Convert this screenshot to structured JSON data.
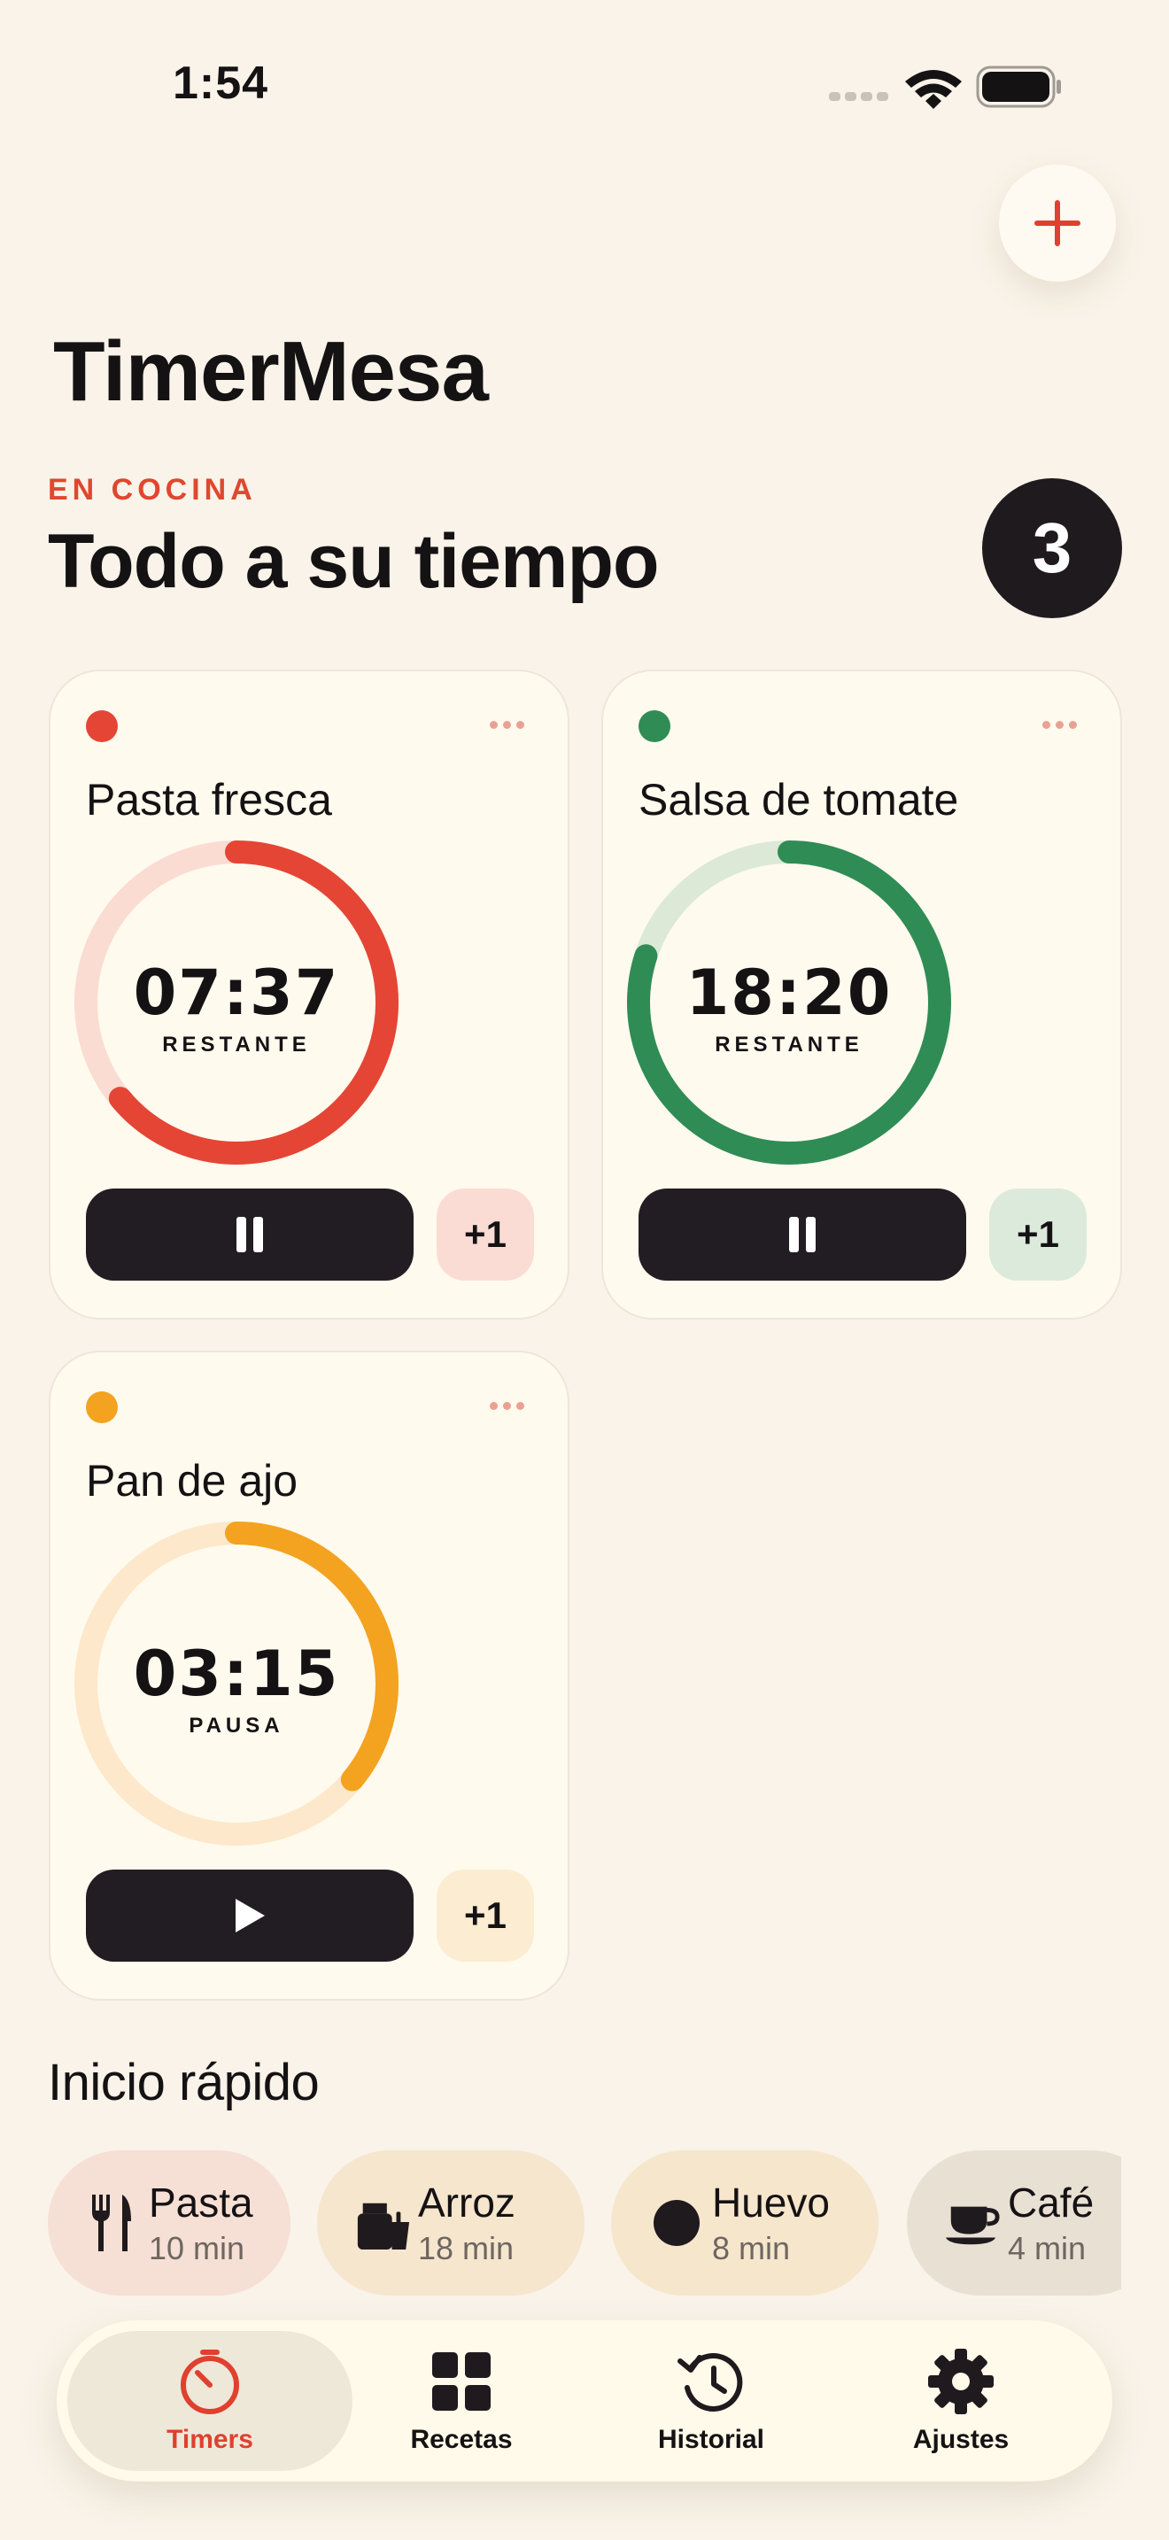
{
  "status_bar": {
    "time": "1:54"
  },
  "app": {
    "title": "TimerMesa"
  },
  "hero": {
    "eyebrow": "EN COCINA",
    "headline": "Todo a su tiempo",
    "active_count": "3"
  },
  "colors": {
    "red": "#e54535",
    "green": "#2f8c55",
    "orange": "#f3a31f",
    "red_soft": "#fbdcd3",
    "green_soft": "#ddebd9",
    "orange_soft": "#fdebd0"
  },
  "timers": [
    {
      "name": "Pasta fresca",
      "time": "07:37",
      "status": "RESTANTE",
      "progress": 0.64,
      "state": "running",
      "add_label": "+1",
      "color": "#e54535",
      "track": "#fadcd2",
      "plus_bg": "#fbdcd4"
    },
    {
      "name": "Salsa de tomate",
      "time": "18:20",
      "status": "RESTANTE",
      "progress": 0.8,
      "state": "running",
      "add_label": "+1",
      "color": "#2f8c55",
      "track": "#dbe9d6",
      "plus_bg": "#dceadb"
    },
    {
      "name": "Pan de ajo",
      "time": "03:15",
      "status": "PAUSA",
      "progress": 0.36,
      "state": "paused",
      "add_label": "+1",
      "color": "#f3a31f",
      "track": "#fde8cb",
      "plus_bg": "#fcecd2"
    }
  ],
  "quick_start": {
    "title": "Inicio rápido",
    "items": [
      {
        "name": "Pasta",
        "duration": "10 min",
        "icon": "fork-knife-icon",
        "bg": "#f6dfd4"
      },
      {
        "name": "Arroz",
        "duration": "18 min",
        "icon": "takeout-bag-icon",
        "bg": "#f5e6cd"
      },
      {
        "name": "Huevo",
        "duration": "8 min",
        "icon": "egg-icon",
        "bg": "#f6e6cc"
      },
      {
        "name": "Café",
        "duration": "4 min",
        "icon": "coffee-cup-icon",
        "bg": "#e9e0d4"
      }
    ]
  },
  "tabs": [
    {
      "label": "Timers",
      "icon": "timer-icon",
      "active": true
    },
    {
      "label": "Recetas",
      "icon": "grid-icon",
      "active": false
    },
    {
      "label": "Historial",
      "icon": "history-icon",
      "active": false
    },
    {
      "label": "Ajustes",
      "icon": "gear-icon",
      "active": false
    }
  ]
}
